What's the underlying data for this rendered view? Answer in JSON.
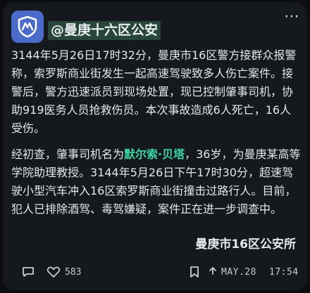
{
  "post": {
    "account_name": "@曼庚十六区公安",
    "paragraph1": "3144年5月26日17时32分，曼庚市16区警方接群众报警称，索罗斯商业街发生一起高速驾驶致多人伤亡案件。接警后，警方迅速派员到现场处置，现已控制肇事司机，协助919医务人员抢救伤员。本次事故造成6人死亡，16人受伤。",
    "paragraph2_before": "经初查，肇事司机名为",
    "paragraph2_name": "默尔索·贝塔",
    "paragraph2_after": "，36岁，为曼庚某高等学院助理教授。3144年5月26日下午17时30分，超速驾驶小型汽车冲入16区索罗斯商业街撞击过路行人。目前，犯人已排除酒驾、毒驾嫌疑，案件正在进一步调查中。",
    "signature": "曼庚市16区公安所"
  },
  "footer": {
    "like_count": "583",
    "date": "MAY.28",
    "time": "17:54"
  },
  "colors": {
    "background": "#15191d",
    "highlight": "#3ed3a0",
    "avatar": "#4a6cc8",
    "account_bg": "#28463a"
  },
  "icons": {
    "avatar": "police-badge-icon",
    "menu": "more-options-icon",
    "comment": "comment-icon",
    "like": "heart-icon",
    "bookmark": "bookmark-icon",
    "share": "share-icon"
  }
}
